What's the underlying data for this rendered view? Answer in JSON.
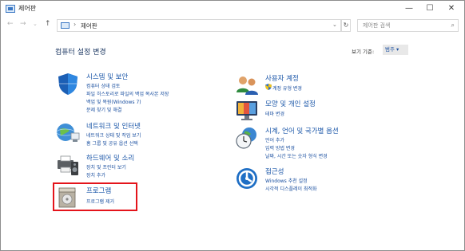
{
  "window": {
    "title": "제어판",
    "minimize": "—",
    "maximize": "☐",
    "close": "✕"
  },
  "nav": {
    "back": "←",
    "forward": "→",
    "recent": "⌄",
    "up": "↑"
  },
  "address": {
    "separator": "›",
    "path": "제어판",
    "dropdown": "⌄",
    "refresh": "↻"
  },
  "search": {
    "placeholder": "제어판 검색",
    "icon": "⌕"
  },
  "main": {
    "heading": "컴퓨터 설정 변경",
    "view_by_label": "보기 기준:",
    "view_by_value": "범주 ▾"
  },
  "left_categories": [
    {
      "title": "시스템 및 보안",
      "icon": "shield-icon",
      "links": [
        "컴퓨터 상태 검토",
        "파일 히스토리로 파일의 백업 복사본 저장",
        "백업 및 복원(Windows 7)",
        "문제 찾기 및 해결"
      ]
    },
    {
      "title": "네트워크 및 인터넷",
      "icon": "network-globe-icon",
      "links": [
        "네트워크 상태 및 작업 보기",
        "홈 그룹 및 공유 옵션 선택"
      ]
    },
    {
      "title": "하드웨어 및 소리",
      "icon": "printer-speaker-icon",
      "links": [
        "장치 및 프린터 보기",
        "장치 추가"
      ]
    },
    {
      "title": "프로그램",
      "icon": "programs-box-icon",
      "links": [
        "프로그램 제거"
      ]
    }
  ],
  "right_categories": [
    {
      "title": "사용자 계정",
      "icon": "users-icon",
      "links": [
        "계정 유형 변경"
      ]
    },
    {
      "title": "모양 및 개인 설정",
      "icon": "display-icon",
      "links": [
        "테마 변경"
      ]
    },
    {
      "title": "시계, 언어 및 국가별 옵션",
      "icon": "clock-globe-icon",
      "links": [
        "언어 추가",
        "입력 방법 변경",
        "날짜, 시간 또는 숫자 형식 변경"
      ]
    },
    {
      "title": "접근성",
      "icon": "ease-of-access-icon",
      "links": [
        "Windows 추천 설정",
        "시각적 디스플레이 최적화"
      ]
    }
  ],
  "colors": {
    "link": "#1a4fa0",
    "title": "#1a56a8",
    "highlight_border": "#e4141b"
  }
}
